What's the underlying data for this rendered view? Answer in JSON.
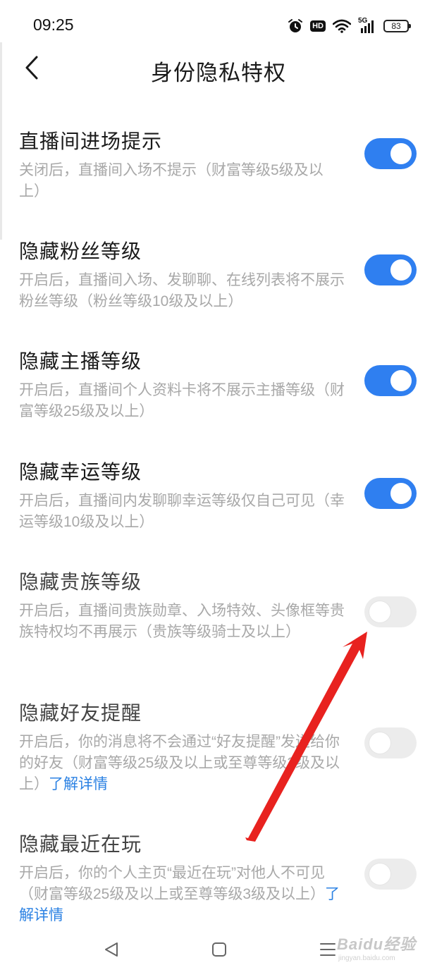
{
  "status_bar": {
    "time": "09:25",
    "icons": [
      "alarm-icon",
      "hd-icon",
      "wifi-icon",
      "signal-5g-icon",
      "battery-icon"
    ],
    "hd_label": "HD",
    "network_label": "5G",
    "battery_level": "83"
  },
  "header": {
    "back_icon": "back-chevron-icon",
    "title": "身份隐私特权"
  },
  "settings": [
    {
      "title": "直播间进场提示",
      "desc": "关闭后，直播间入场不提示（财富等级5级及以上）",
      "enabled": true
    },
    {
      "title": "隐藏粉丝等级",
      "desc": "开启后，直播间入场、发聊聊、在线列表将不展示粉丝等级（粉丝等级10级及以上）",
      "enabled": true
    },
    {
      "title": "隐藏主播等级",
      "desc": "开启后，直播间个人资料卡将不展示主播等级（财富等级25级及以上）",
      "enabled": true
    },
    {
      "title": "隐藏幸运等级",
      "desc": "开启后，直播间内发聊聊幸运等级仅自己可见（幸运等级10级及以上）",
      "enabled": true
    },
    {
      "title": "隐藏贵族等级",
      "desc": "开启后，直播间贵族勋章、入场特效、头像框等贵族特权均不再展示（贵族等级骑士及以上）",
      "enabled": false
    },
    {
      "title": "隐藏好友提醒",
      "desc": "开启后，你的消息将不会通过“好友提醒”发送给你的好友（财富等级25级及以上或至尊等级3级及以上）",
      "link": "了解详情",
      "enabled": false
    },
    {
      "title": "隐藏最近在玩",
      "desc": "开启后，你的个人主页“最近在玩”对他人不可见（财富等级25级及以上或至尊等级3级及以上）",
      "link": "了解详情",
      "enabled": false
    }
  ],
  "bottom_nav": {
    "icons": [
      "back-triangle-icon",
      "home-square-icon",
      "menu-lines-icon"
    ]
  },
  "watermark": {
    "text": "Baidu经验",
    "sub": "jingyan.baidu.com"
  },
  "colors": {
    "toggle_on": "#2f7ff0",
    "toggle_off": "#ececec",
    "link": "#2c82e3",
    "annotation_arrow": "#e8221f"
  }
}
